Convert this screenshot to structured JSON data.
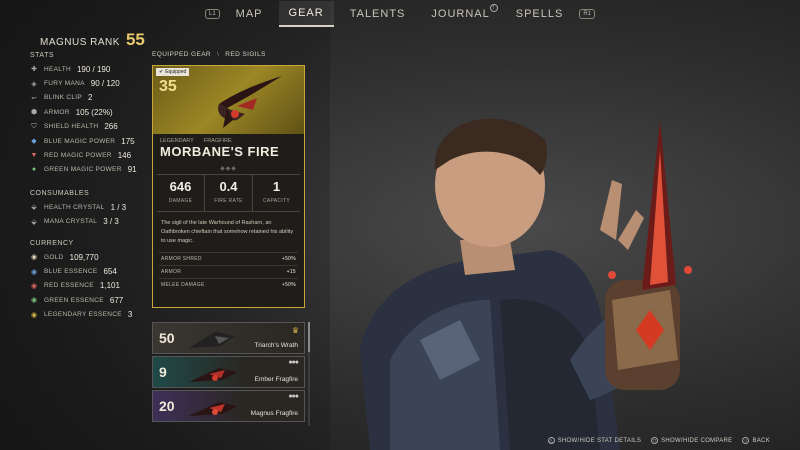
{
  "nav": {
    "left_hint": "L1",
    "right_hint": "R1",
    "tabs": [
      {
        "label": "MAP"
      },
      {
        "label": "GEAR"
      },
      {
        "label": "TALENTS"
      },
      {
        "label": "JOURNAL"
      },
      {
        "label": "SPELLS"
      }
    ],
    "active": "GEAR",
    "journal_badge": "!"
  },
  "rank": {
    "label": "MAGNUS RANK",
    "value": "55"
  },
  "stats": {
    "title": "STATS",
    "items": [
      {
        "icon": "health-icon",
        "name": "HEALTH",
        "value": "190 / 190"
      },
      {
        "icon": "fury-mana-icon",
        "name": "FURY MANA",
        "value": "90 / 120"
      },
      {
        "icon": "blink-icon",
        "name": "BLINK CLIP",
        "value": "2"
      },
      {
        "icon": "armor-icon",
        "name": "ARMOR",
        "value": "105 (22%)"
      },
      {
        "icon": "shield-icon",
        "name": "SHIELD HEALTH",
        "value": "266"
      },
      {
        "icon": "blue-magic-icon",
        "name": "BLUE MAGIC POWER",
        "value": "175"
      },
      {
        "icon": "red-magic-icon",
        "name": "RED MAGIC POWER",
        "value": "146"
      },
      {
        "icon": "green-magic-icon",
        "name": "GREEN MAGIC POWER",
        "value": "91"
      }
    ]
  },
  "consumables": {
    "title": "CONSUMABLES",
    "items": [
      {
        "icon": "health-crystal-icon",
        "name": "HEALTH CRYSTAL",
        "value": "1 / 3"
      },
      {
        "icon": "mana-crystal-icon",
        "name": "MANA CRYSTAL",
        "value": "3 / 3"
      }
    ]
  },
  "currency": {
    "title": "CURRENCY",
    "items": [
      {
        "icon": "gold-icon",
        "name": "GOLD",
        "value": "109,770"
      },
      {
        "icon": "blue-essence-icon",
        "name": "BLUE ESSENCE",
        "value": "654"
      },
      {
        "icon": "red-essence-icon",
        "name": "RED ESSENCE",
        "value": "1,101"
      },
      {
        "icon": "green-essence-icon",
        "name": "GREEN ESSENCE",
        "value": "677"
      },
      {
        "icon": "legendary-essence-icon",
        "name": "LEGENDARY ESSENCE",
        "value": "3"
      }
    ]
  },
  "breadcrumb": {
    "first": "EQUIPPED GEAR",
    "separator": "\\",
    "second": "RED SIGILS"
  },
  "equipped_card": {
    "tag": "Equipped",
    "level": "35",
    "rarity": "LEGENDARY",
    "category": "FRAGFIRE",
    "name": "MORBANE'S FIRE",
    "stats": [
      {
        "value": "646",
        "label": "DAMAGE"
      },
      {
        "value": "0.4",
        "label": "FIRE RATE"
      },
      {
        "value": "1",
        "label": "CAPACITY"
      }
    ],
    "description": "The sigil of the late Warhound of Rasharn, an Oathbroken chieftain that somehow retained his ability to use magic.",
    "bonuses": [
      {
        "name": "ARMOR SHRED",
        "value": "+50%"
      },
      {
        "name": "ARMOR",
        "value": "+15"
      },
      {
        "name": "MELEE DAMAGE",
        "value": "+50%"
      }
    ],
    "accent": "#c7a63a"
  },
  "sigil_list": [
    {
      "level": "50",
      "name": "Triarch's Wrath",
      "marker": "crown",
      "color": "#3a3631"
    },
    {
      "level": "9",
      "name": "Ember Fragfire",
      "marker": "dots",
      "color": "#1f4a48"
    },
    {
      "level": "20",
      "name": "Magnus Fragfire",
      "marker": "dots",
      "color": "#3f2f58"
    }
  ],
  "hints": [
    {
      "glyph": "△",
      "label": "SHOW/HIDE STAT DETAILS"
    },
    {
      "glyph": "□",
      "label": "SHOW/HIDE COMPARE"
    },
    {
      "glyph": "○",
      "label": "BACK"
    }
  ]
}
